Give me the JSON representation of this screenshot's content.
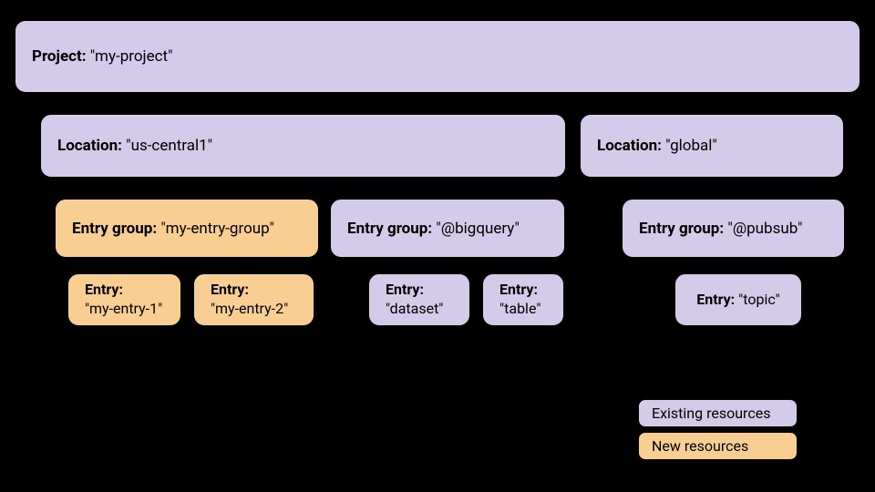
{
  "project": {
    "label": "Project",
    "value": "\"my-project\""
  },
  "locations": [
    {
      "label": "Location",
      "value": "\"us-central1\"",
      "entryGroups": [
        {
          "label": "Entry group",
          "value": "\"my-entry-group\"",
          "isNew": true,
          "entries": [
            {
              "label": "Entry",
              "value": "\"my-entry-1\"",
              "isNew": true
            },
            {
              "label": "Entry",
              "value": "\"my-entry-2\"",
              "isNew": true
            }
          ]
        },
        {
          "label": "Entry group",
          "value": "\"@bigquery\"",
          "isNew": false,
          "entries": [
            {
              "label": "Entry",
              "value": "\"dataset\"",
              "isNew": false
            },
            {
              "label": "Entry",
              "value": "\"table\"",
              "isNew": false
            }
          ]
        }
      ]
    },
    {
      "label": "Location",
      "value": "\"global\"",
      "entryGroups": [
        {
          "label": "Entry group",
          "value": "\"@pubsub\"",
          "isNew": false,
          "entries": [
            {
              "label": "Entry",
              "value": "\"topic\"",
              "isNew": false
            }
          ]
        }
      ]
    }
  ],
  "legend": {
    "existing": "Existing resources",
    "new": "New resources"
  }
}
